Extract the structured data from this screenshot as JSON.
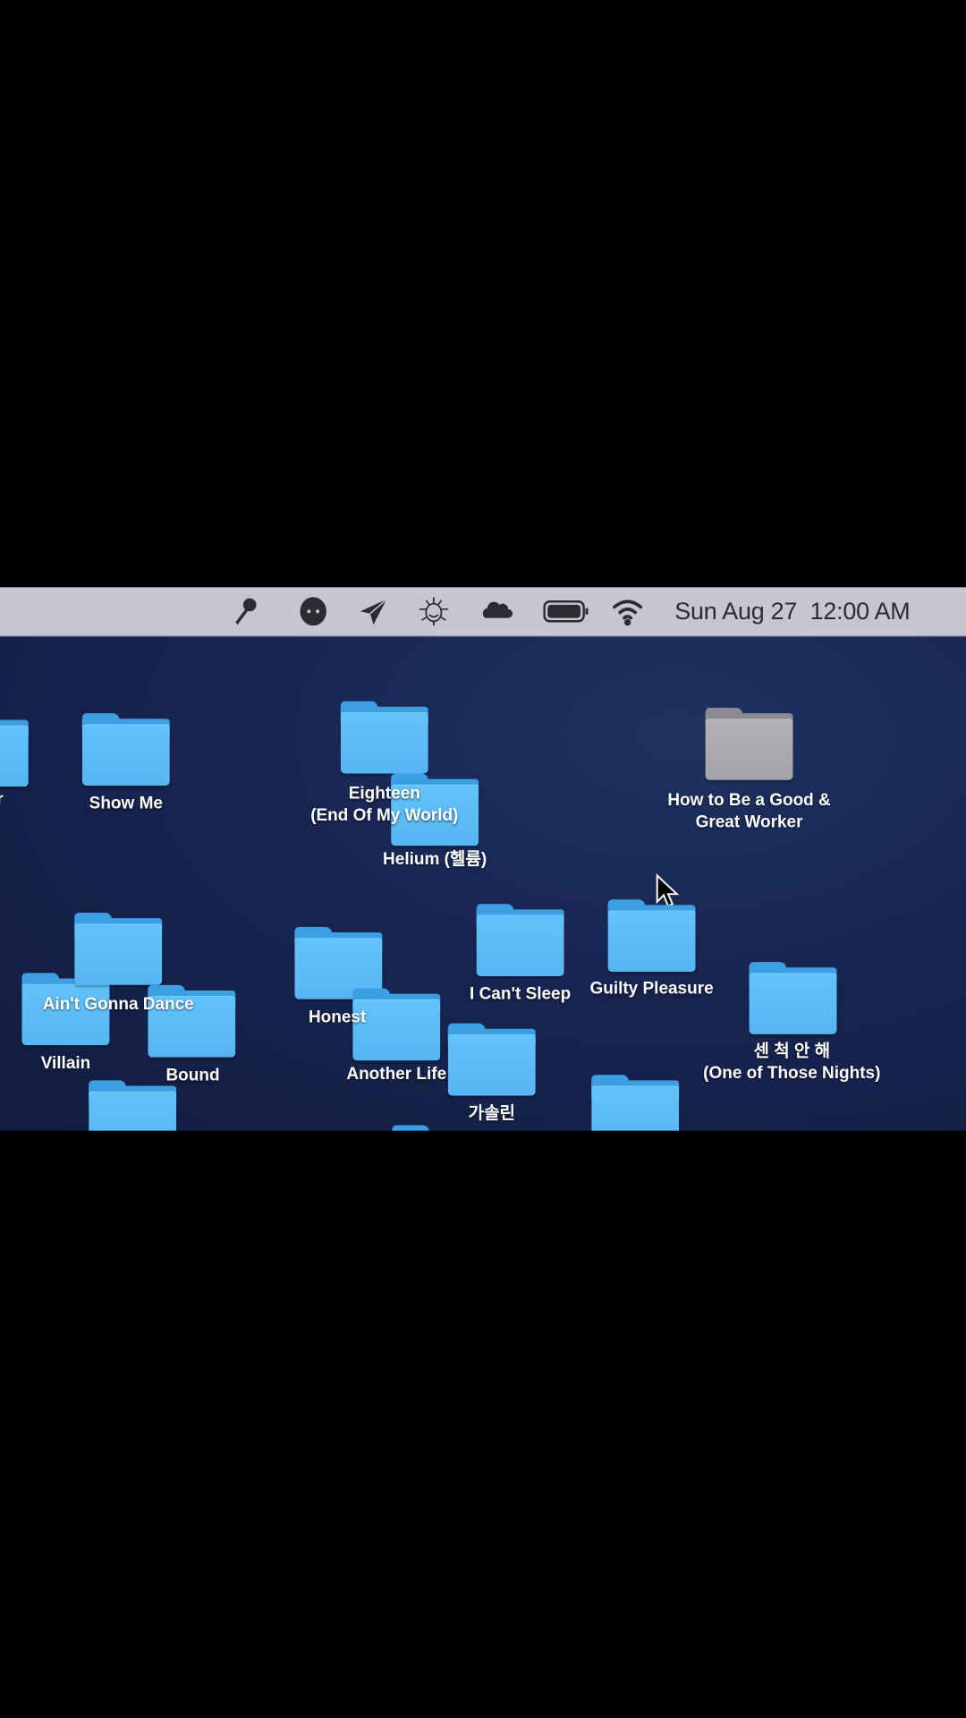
{
  "menubar": {
    "icons": [
      "key-icon",
      "ghost-icon",
      "paper-plane-icon",
      "bug-icon",
      "cloud-icon",
      "battery-icon",
      "wifi-icon"
    ],
    "day": "Sun",
    "date": "Aug 27",
    "time": "12:00 AM"
  },
  "desktop": {
    "folders": [
      {
        "label": "r",
        "color": "blue"
      },
      {
        "label": "Show Me",
        "color": "blue"
      },
      {
        "label": "Helium (헬륨)",
        "color": "blue"
      },
      {
        "label": "Eighteen\n(End Of My World)",
        "color": "blue"
      },
      {
        "label": "How to Be a Good &\nGreat Worker",
        "color": "gray"
      },
      {
        "label": "Ain't Gonna Dance",
        "color": "blue"
      },
      {
        "label": "Villain",
        "color": "blue"
      },
      {
        "label": "Bound",
        "color": "blue"
      },
      {
        "label": "Honest",
        "color": "blue"
      },
      {
        "label": "Another Life",
        "color": "blue"
      },
      {
        "label": "I Can't Sleep",
        "color": "blue"
      },
      {
        "label": "Guilty Pleasure",
        "color": "blue"
      },
      {
        "label": "센 척 안 해\n(One of Those Nights)",
        "color": "blue"
      },
      {
        "label": "가솔린",
        "color": "blue"
      },
      {
        "label": "",
        "color": "blue"
      },
      {
        "label": "",
        "color": "blue"
      },
      {
        "label": "",
        "color": "blue"
      }
    ]
  },
  "colors": {
    "folder_blue": "#5bbcf6",
    "folder_gray": "#a9a8ad",
    "menubar": "#c6c5d0",
    "desktop": "#172552"
  }
}
